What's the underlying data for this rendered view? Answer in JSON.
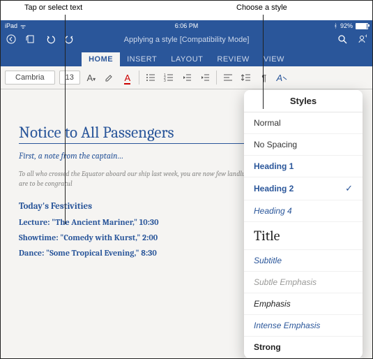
{
  "callouts": {
    "tap": "Tap or select text",
    "style": "Choose a style"
  },
  "status": {
    "device": "iPad",
    "wifi": "ᯤ",
    "time": "6:06 PM",
    "bt": "92%"
  },
  "titlebar": {
    "back": "←",
    "file": "",
    "undo": "↶",
    "redo": "↷",
    "doc": "Applying a style [Compatibility Mode]",
    "search": "",
    "share": ""
  },
  "tabs": [
    "HOME",
    "INSERT",
    "LAYOUT",
    "REVIEW",
    "VIEW"
  ],
  "ribbon": {
    "font": "Cambria",
    "size": "13"
  },
  "doc": {
    "h1": "Notice to All Passengers",
    "caption": "First, a note from the captain…",
    "body": "To all who crossed the Equator aboard our ship last week, you are now\nfew landlubbers have accomplished this feat. You are to be congratul",
    "h3": "Today's Festivities",
    "e1": "Lecture: \"The Ancient Mariner,\" 10:30",
    "e2": "Showtime: \"Comedy with Kurst,\" 2:00",
    "e3": "Dance: \"Some Tropical Evening,\" 8:30"
  },
  "popover": {
    "title": "Styles",
    "items": [
      {
        "label": "Normal",
        "cls": "st-normal"
      },
      {
        "label": "No Spacing",
        "cls": "st-normal"
      },
      {
        "label": "Heading 1",
        "cls": "st-h1"
      },
      {
        "label": "Heading 2",
        "cls": "st-h2",
        "sel": true
      },
      {
        "label": "Heading 4",
        "cls": "st-h4"
      },
      {
        "label": "Title",
        "cls": "st-title"
      },
      {
        "label": "Subtitle",
        "cls": "st-sub"
      },
      {
        "label": "Subtle Emphasis",
        "cls": "st-sube"
      },
      {
        "label": "Emphasis",
        "cls": "st-emph"
      },
      {
        "label": "Intense Emphasis",
        "cls": "st-int"
      },
      {
        "label": "Strong",
        "cls": "st-strong"
      }
    ]
  }
}
